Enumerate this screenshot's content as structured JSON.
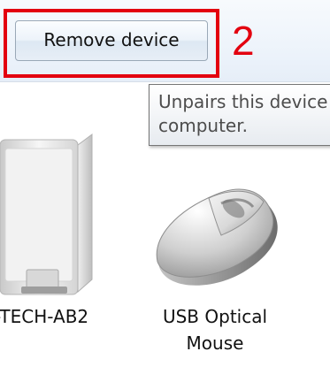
{
  "toolbar": {
    "remove_device_label": "Remove device"
  },
  "annotation": {
    "step_number": "2",
    "color": "#e3000f"
  },
  "tooltip": {
    "line1": "Unpairs this device",
    "line2": "computer."
  },
  "devices": [
    {
      "name": "-TECH-AB2",
      "icon": "computer-tower-icon"
    },
    {
      "name_line1": "USB Optical",
      "name_line2": "Mouse",
      "icon": "mouse-icon"
    }
  ]
}
